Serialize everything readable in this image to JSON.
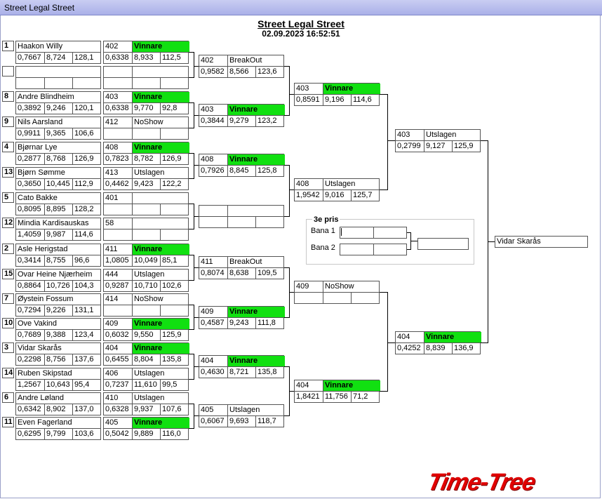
{
  "window": {
    "title": "Street Legal Street"
  },
  "header": {
    "title": "Street Legal Street",
    "datetime": "02.09.2023 16:52:51"
  },
  "r1": [
    {
      "seed": "1",
      "name": "Haakon Willy",
      "rt": "0,7667",
      "et": "8,724",
      "sp": "128,1"
    },
    {
      "seed": "",
      "name": "",
      "rt": "",
      "et": "",
      "sp": ""
    },
    {
      "seed": "8",
      "name": "Andre Blindheim",
      "rt": "0,3892",
      "et": "9,246",
      "sp": "120,1"
    },
    {
      "seed": "9",
      "name": "Nils Aarsland",
      "rt": "0,9911",
      "et": "9,365",
      "sp": "106,6"
    },
    {
      "seed": "4",
      "name": "Bjørnar Lye",
      "rt": "0,2877",
      "et": "8,768",
      "sp": "126,9"
    },
    {
      "seed": "13",
      "name": "Bjørn Sømme",
      "rt": "0,3650",
      "et": "10,445",
      "sp": "112,9"
    },
    {
      "seed": "5",
      "name": "Cato Bakke",
      "rt": "0,8095",
      "et": "8,895",
      "sp": "128,2"
    },
    {
      "seed": "12",
      "name": "Mindia Kardisauskas",
      "rt": "1,4059",
      "et": "9,987",
      "sp": "114,6"
    },
    {
      "seed": "2",
      "name": "Asle Herigstad",
      "rt": "0,3414",
      "et": "8,755",
      "sp": "96,6"
    },
    {
      "seed": "15",
      "name": "Ovar Heine Njærheim",
      "rt": "0,8864",
      "et": "10,726",
      "sp": "104,3"
    },
    {
      "seed": "7",
      "name": "Øystein Fossum",
      "rt": "0,7294",
      "et": "9,226",
      "sp": "131,1"
    },
    {
      "seed": "10",
      "name": "Ove Vakind",
      "rt": "0,7689",
      "et": "9,388",
      "sp": "123,4"
    },
    {
      "seed": "3",
      "name": "Vidar Skarås",
      "rt": "0,2298",
      "et": "8,756",
      "sp": "137,6"
    },
    {
      "seed": "14",
      "name": "Ruben Skipstad",
      "rt": "1,2567",
      "et": "10,643",
      "sp": "95,4"
    },
    {
      "seed": "6",
      "name": "Andre Løland",
      "rt": "0,6342",
      "et": "8,902",
      "sp": "137,0"
    },
    {
      "seed": "11",
      "name": "Even Fagerland",
      "rt": "0,6295",
      "et": "9,799",
      "sp": "103,6"
    }
  ],
  "r2": [
    {
      "car": "402",
      "res": "Vinnare",
      "win": true,
      "rt": "0,6338",
      "et": "8,933",
      "sp": "112,5"
    },
    {
      "car": "",
      "res": "",
      "win": false,
      "rt": "",
      "et": "",
      "sp": ""
    },
    {
      "car": "403",
      "res": "Vinnare",
      "win": true,
      "rt": "0,6338",
      "et": "9,770",
      "sp": "92,8"
    },
    {
      "car": "412",
      "res": "NoShow",
      "win": false,
      "rt": "",
      "et": "",
      "sp": ""
    },
    {
      "car": "408",
      "res": "Vinnare",
      "win": true,
      "rt": "0,7823",
      "et": "8,782",
      "sp": "126,9"
    },
    {
      "car": "413",
      "res": "Utslagen",
      "win": false,
      "rt": "0,4462",
      "et": "9,423",
      "sp": "122,2"
    },
    {
      "car": "401",
      "res": "",
      "win": false,
      "rt": "",
      "et": "",
      "sp": ""
    },
    {
      "car": "58",
      "res": "",
      "win": false,
      "rt": "",
      "et": "",
      "sp": ""
    },
    {
      "car": "411",
      "res": "Vinnare",
      "win": true,
      "rt": "1,0805",
      "et": "10,049",
      "sp": "85,1"
    },
    {
      "car": "444",
      "res": "Utslagen",
      "win": false,
      "rt": "0,9287",
      "et": "10,710",
      "sp": "102,6"
    },
    {
      "car": "414",
      "res": "NoShow",
      "win": false,
      "rt": "",
      "et": "",
      "sp": ""
    },
    {
      "car": "409",
      "res": "Vinnare",
      "win": true,
      "rt": "0,6032",
      "et": "9,550",
      "sp": "125,9"
    },
    {
      "car": "404",
      "res": "Vinnare",
      "win": true,
      "rt": "0,6455",
      "et": "8,804",
      "sp": "135,8"
    },
    {
      "car": "406",
      "res": "Utslagen",
      "win": false,
      "rt": "0,7237",
      "et": "11,610",
      "sp": "99,5"
    },
    {
      "car": "410",
      "res": "Utslagen",
      "win": false,
      "rt": "0,6328",
      "et": "9,937",
      "sp": "107,6"
    },
    {
      "car": "405",
      "res": "Vinnare",
      "win": true,
      "rt": "0,5042",
      "et": "9,889",
      "sp": "116,0"
    }
  ],
  "r3": [
    {
      "car": "402",
      "res": "BreakOut",
      "win": false,
      "rt": "0,9582",
      "et": "8,566",
      "sp": "123,6"
    },
    {
      "car": "403",
      "res": "Vinnare",
      "win": true,
      "rt": "0,3844",
      "et": "9,279",
      "sp": "123,2"
    },
    {
      "car": "408",
      "res": "Vinnare",
      "win": true,
      "rt": "0,7926",
      "et": "8,845",
      "sp": "125,8"
    },
    {
      "car": "",
      "res": "",
      "win": false,
      "rt": "",
      "et": "",
      "sp": ""
    },
    {
      "car": "411",
      "res": "BreakOut",
      "win": false,
      "rt": "0,8074",
      "et": "8,638",
      "sp": "109,5"
    },
    {
      "car": "409",
      "res": "Vinnare",
      "win": true,
      "rt": "0,4587",
      "et": "9,243",
      "sp": "111,8"
    },
    {
      "car": "404",
      "res": "Vinnare",
      "win": true,
      "rt": "0,4630",
      "et": "8,721",
      "sp": "135,8"
    },
    {
      "car": "405",
      "res": "Utslagen",
      "win": false,
      "rt": "0,6067",
      "et": "9,693",
      "sp": "118,7"
    }
  ],
  "r4": [
    {
      "car": "403",
      "res": "Vinnare",
      "win": true,
      "rt": "0,8591",
      "et": "9,196",
      "sp": "114,6"
    },
    {
      "car": "408",
      "res": "Utslagen",
      "win": false,
      "rt": "1,9542",
      "et": "9,016",
      "sp": "125,7"
    },
    {
      "car": "409",
      "res": "NoShow",
      "win": false,
      "rt": "",
      "et": "",
      "sp": ""
    },
    {
      "car": "404",
      "res": "Vinnare",
      "win": true,
      "rt": "1,8421",
      "et": "11,756",
      "sp": "71,2"
    }
  ],
  "r5": [
    {
      "car": "403",
      "res": "Utslagen",
      "win": false,
      "rt": "0,2799",
      "et": "9,127",
      "sp": "125,9"
    },
    {
      "car": "404",
      "res": "Vinnare",
      "win": true,
      "rt": "0,4252",
      "et": "8,839",
      "sp": "136,9"
    }
  ],
  "winner": "Vidar Skarås",
  "third_place": {
    "title": "3e pris",
    "lane1": "Bana 1",
    "lane2": "Bana 2"
  },
  "logo": "Time-Tree",
  "colors": {
    "winner_green": "#11e011",
    "logo_red": "#e00000",
    "titlebar": "#aab0e8"
  }
}
